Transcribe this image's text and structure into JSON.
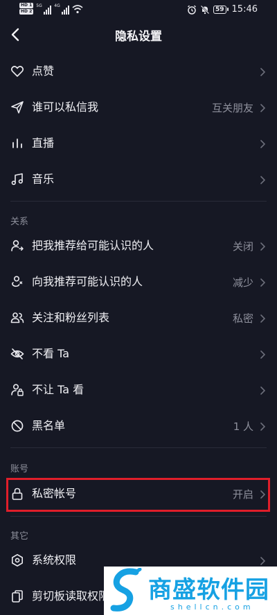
{
  "status_bar": {
    "hd1": "HD 1",
    "hd2": "HD 2",
    "sig1": "5G",
    "sig2": "4G",
    "battery": "59",
    "time": "15:46"
  },
  "header": {
    "title": "隐私设置"
  },
  "rows": [
    {
      "label": "点赞",
      "value": "",
      "icon": "heart-icon"
    },
    {
      "label": "谁可以私信我",
      "value": "互关朋友",
      "icon": "send-icon"
    },
    {
      "label": "直播",
      "value": "",
      "icon": "live-bars-icon"
    },
    {
      "label": "音乐",
      "value": "",
      "icon": "music-note-icon"
    },
    {
      "label": "把我推荐给可能认识的人",
      "value": "关闭",
      "icon": "user-recommend-icon"
    },
    {
      "label": "向我推荐可能认识的人",
      "value": "减少",
      "icon": "user-discover-icon"
    },
    {
      "label": "关注和粉丝列表",
      "value": "私密",
      "icon": "users-icon"
    },
    {
      "label": "不看 Ta",
      "value": "",
      "icon": "eye-off-icon"
    },
    {
      "label": "不让 Ta 看",
      "value": "",
      "icon": "user-lock-icon"
    },
    {
      "label": "黑名单",
      "value": "1 人",
      "icon": "block-icon"
    },
    {
      "label": "私密帐号",
      "value": "开启",
      "icon": "lock-icon"
    },
    {
      "label": "系统权限",
      "value": "",
      "icon": "hexagon-settings-icon"
    },
    {
      "label": "剪切板读取权限",
      "value": "",
      "icon": "clipboard-icon"
    }
  ],
  "sections": {
    "relations": "关系",
    "account": "账号",
    "other": "其它"
  },
  "watermark": {
    "text": "商盛软件园",
    "url": "shellcn.com"
  },
  "colors": {
    "background": "#161824",
    "highlight": "#e01e2a",
    "watermark": "#16a1e3"
  }
}
